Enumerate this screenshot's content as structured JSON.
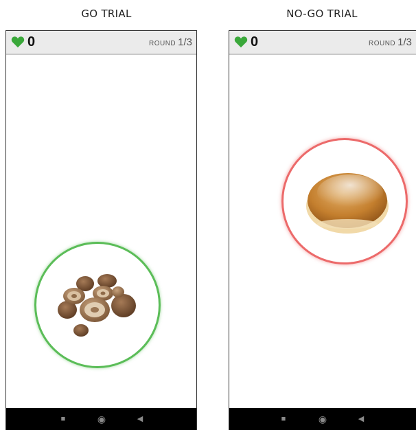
{
  "captions": {
    "go": "GO TRIAL",
    "nogo": "NO-GO TRIAL"
  },
  "go_panel": {
    "score": "0",
    "round_label": "ROUND",
    "round_value": "1/3",
    "stimulus": "mushrooms",
    "circle_color": "#5bbd58"
  },
  "nogo_panel": {
    "score": "0",
    "round_label": "ROUND",
    "round_value": "1/3",
    "stimulus": "sugared doughnut",
    "circle_color": "#ec6a6a"
  },
  "icons": {
    "score": "heart-icon",
    "nav": [
      "recents-square-icon",
      "home-circle-icon",
      "back-triangle-icon"
    ]
  },
  "colors": {
    "heart": "#3aa83a",
    "status_bar": "#ebebeb",
    "navbar": "#000000"
  }
}
